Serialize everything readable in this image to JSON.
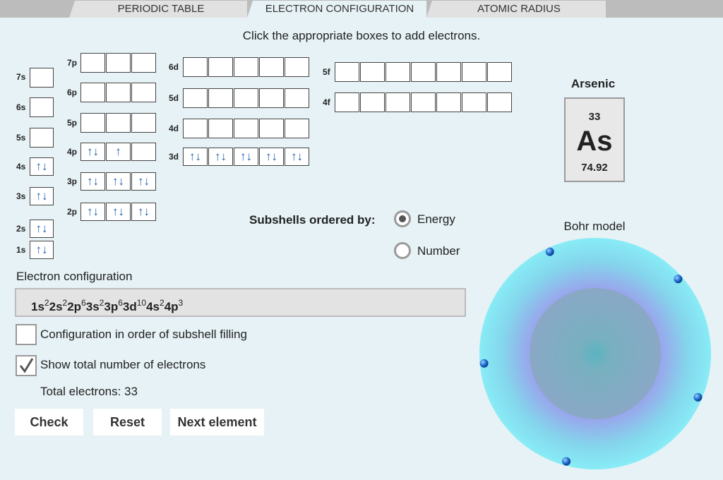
{
  "tabs": [
    {
      "label": "PERIODIC TABLE"
    },
    {
      "label": "ELECTRON CONFIGURATION"
    },
    {
      "label": "ATOMIC RADIUS"
    }
  ],
  "instruction": "Click the appropriate boxes to add electrons.",
  "arrows": {
    "pair": "↑↓",
    "up": "↑"
  },
  "orbitals": {
    "1s": {
      "label": "1s",
      "boxes": [
        "↑↓"
      ]
    },
    "2s": {
      "label": "2s",
      "boxes": [
        "↑↓"
      ]
    },
    "3s": {
      "label": "3s",
      "boxes": [
        "↑↓"
      ]
    },
    "4s": {
      "label": "4s",
      "boxes": [
        "↑↓"
      ]
    },
    "5s": {
      "label": "5s",
      "boxes": [
        ""
      ]
    },
    "6s": {
      "label": "6s",
      "boxes": [
        ""
      ]
    },
    "7s": {
      "label": "7s",
      "boxes": [
        ""
      ]
    },
    "2p": {
      "label": "2p",
      "boxes": [
        "↑↓",
        "↑↓",
        "↑↓"
      ]
    },
    "3p": {
      "label": "3p",
      "boxes": [
        "↑↓",
        "↑↓",
        "↑↓"
      ]
    },
    "4p": {
      "label": "4p",
      "boxes": [
        "↑↓",
        "↑",
        ""
      ]
    },
    "5p": {
      "label": "5p",
      "boxes": [
        "",
        "",
        ""
      ]
    },
    "6p": {
      "label": "6p",
      "boxes": [
        "",
        "",
        ""
      ]
    },
    "7p": {
      "label": "7p",
      "boxes": [
        "",
        "",
        ""
      ]
    },
    "3d": {
      "label": "3d",
      "boxes": [
        "↑↓",
        "↑↓",
        "↑↓",
        "↑↓",
        "↑↓"
      ]
    },
    "4d": {
      "label": "4d",
      "boxes": [
        "",
        "",
        "",
        "",
        ""
      ]
    },
    "5d": {
      "label": "5d",
      "boxes": [
        "",
        "",
        "",
        "",
        ""
      ]
    },
    "6d": {
      "label": "6d",
      "boxes": [
        "",
        "",
        "",
        "",
        ""
      ]
    },
    "4f": {
      "label": "4f",
      "boxes": [
        "",
        "",
        "",
        "",
        "",
        "",
        ""
      ]
    },
    "5f": {
      "label": "5f",
      "boxes": [
        "",
        "",
        "",
        "",
        "",
        "",
        ""
      ]
    }
  },
  "element": {
    "name": "Arsenic",
    "number": "33",
    "symbol": "As",
    "mass": "74.92"
  },
  "ordering": {
    "label": "Subshells ordered by:",
    "options": [
      {
        "label": "Energy",
        "selected": true
      },
      {
        "label": "Number",
        "selected": false
      }
    ]
  },
  "configuration": {
    "label": "Electron configuration",
    "terms": [
      {
        "sub": "1s",
        "count": "2"
      },
      {
        "sub": "2s",
        "count": "2"
      },
      {
        "sub": "2p",
        "count": "6"
      },
      {
        "sub": "3s",
        "count": "2"
      },
      {
        "sub": "3p",
        "count": "6"
      },
      {
        "sub": "3d",
        "count": "10"
      },
      {
        "sub": "4s",
        "count": "2"
      },
      {
        "sub": "4p",
        "count": "3"
      }
    ]
  },
  "options": {
    "fill_order": {
      "label": "Configuration in order of subshell filling",
      "checked": false
    },
    "show_total": {
      "label": "Show total number of electrons",
      "checked": true
    }
  },
  "total": "Total electrons: 33",
  "buttons": {
    "check": "Check",
    "reset": "Reset",
    "next": "Next element"
  },
  "bohr": {
    "title": "Bohr model",
    "outer_electrons": 5
  },
  "colors": {
    "arrow": "#1f5fb0",
    "tab_active": "#e6f2f6",
    "tab_inactive": "#e1e1e1",
    "electron": "#1f6fd0"
  }
}
